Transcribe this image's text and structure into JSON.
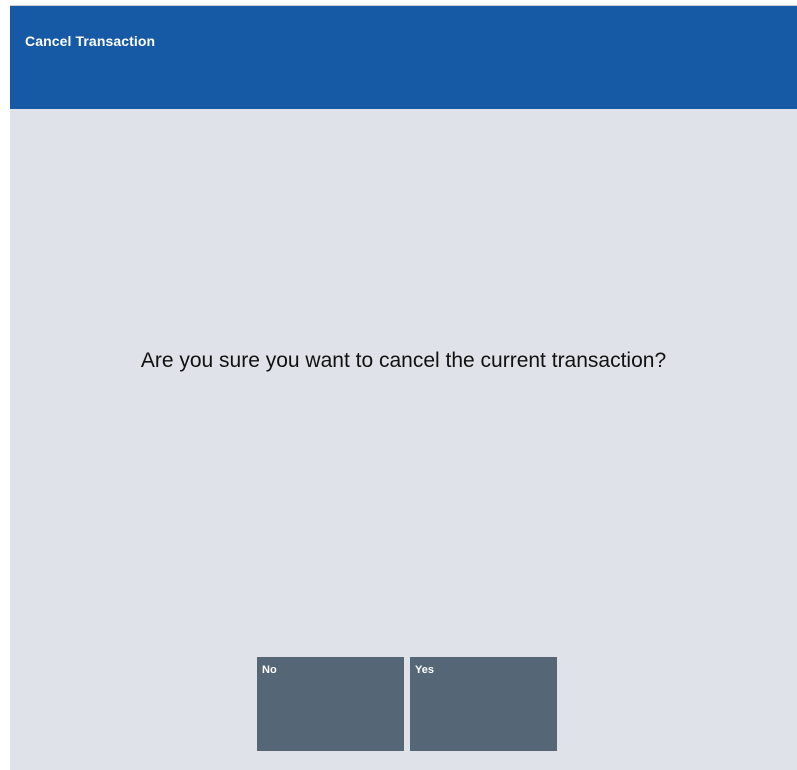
{
  "window": {
    "title": "Cancel Transaction"
  },
  "dialog": {
    "prompt": "Are you sure you want to cancel the current transaction?"
  },
  "buttons": {
    "no_label": "No",
    "yes_label": "Yes"
  },
  "colors": {
    "header_background": "#1659a5",
    "body_background": "#dfe3e9",
    "button_background": "#556677",
    "text_dark": "#111111",
    "text_light": "#ffffff"
  }
}
